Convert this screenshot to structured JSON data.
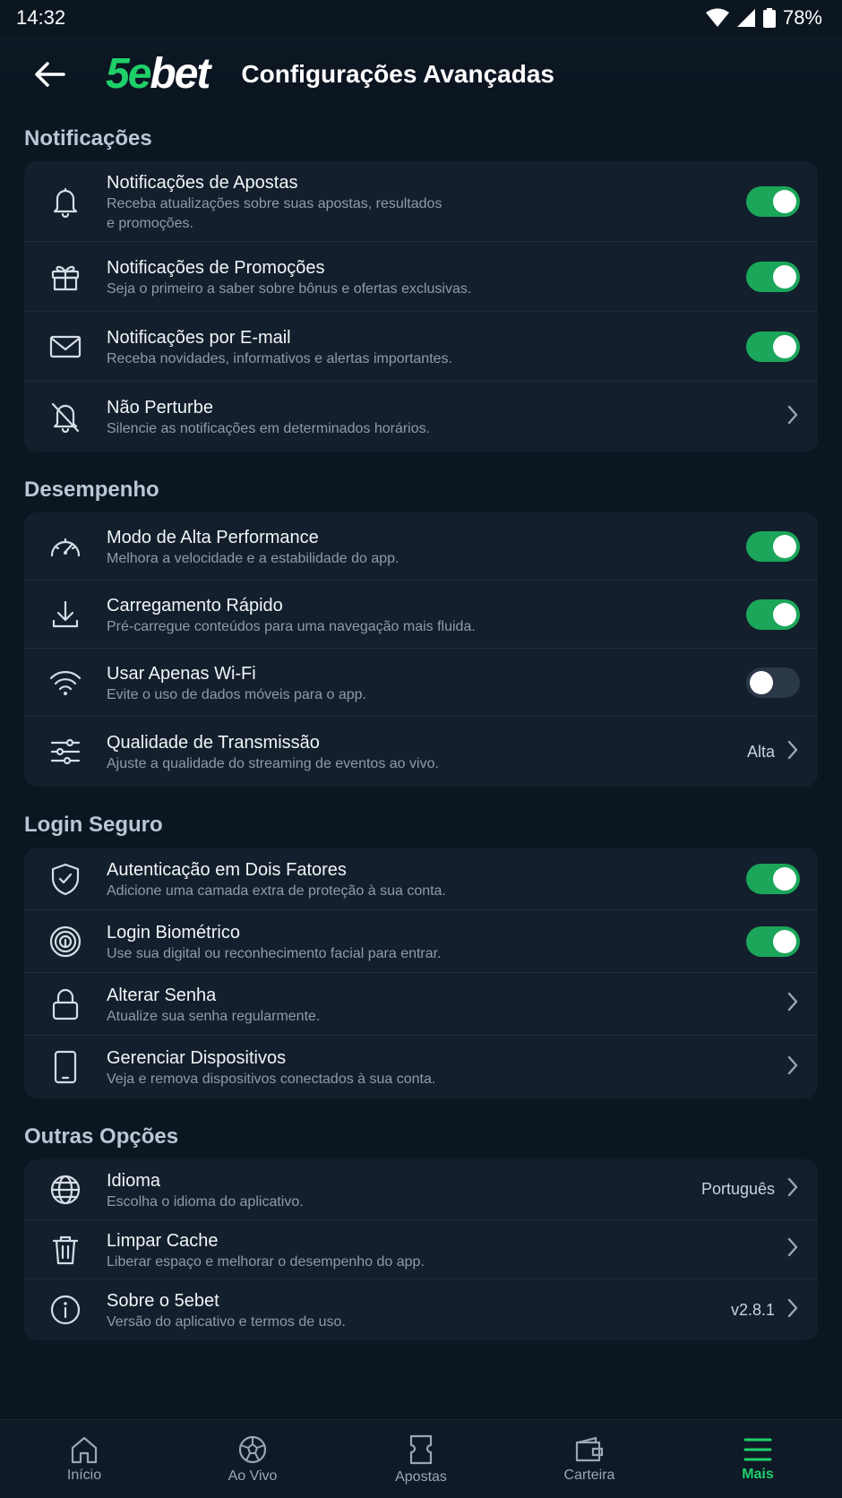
{
  "status": {
    "time": "14:32",
    "battery": "78%"
  },
  "header": {
    "logo_5": "5",
    "logo_e": "e",
    "logo_bet": "bet",
    "title": "Configurações Avançadas"
  },
  "sections": [
    {
      "title": "Notificações",
      "items": [
        {
          "icon": "bell-icon",
          "title": "Notificações de Apostas",
          "subtitle": "Receba atualizações sobre suas apostas, resultados\ne promoções.",
          "control": "toggle",
          "on": true
        },
        {
          "icon": "gift-icon",
          "title": "Notificações de Promoções",
          "subtitle": "Seja o primeiro a saber sobre bônus e ofertas exclusivas.",
          "control": "toggle",
          "on": true
        },
        {
          "icon": "mail-icon",
          "title": "Notificações por E-mail",
          "subtitle": "Receba novidades, informativos e alertas importantes.",
          "control": "toggle",
          "on": true
        },
        {
          "icon": "bell-off-icon",
          "title": "Não Perturbe",
          "subtitle": "Silencie as notificações em determinados horários.",
          "control": "chevron"
        }
      ]
    },
    {
      "title": "Desempenho",
      "items": [
        {
          "icon": "speedometer-icon",
          "title": "Modo de Alta Performance",
          "subtitle": "Melhora a velocidade e a estabilidade do app.",
          "control": "toggle",
          "on": true
        },
        {
          "icon": "download-icon",
          "title": "Carregamento Rápido",
          "subtitle": "Pré-carregue conteúdos para uma navegação mais fluida.",
          "control": "toggle",
          "on": true
        },
        {
          "icon": "wifi-icon",
          "title": "Usar Apenas Wi-Fi",
          "subtitle": "Evite o uso de dados móveis para o app.",
          "control": "toggle",
          "on": false
        },
        {
          "icon": "sliders-icon",
          "title": "Qualidade de Transmissão",
          "subtitle": "Ajuste a qualidade do streaming de eventos ao vivo.",
          "control": "chevron",
          "value": "Alta"
        }
      ]
    },
    {
      "title": "Login Seguro",
      "items": [
        {
          "icon": "shield-check-icon",
          "title": "Autenticação em Dois Fatores",
          "subtitle": "Adicione uma camada extra de proteção à sua conta.",
          "control": "toggle",
          "on": true
        },
        {
          "icon": "fingerprint-icon",
          "title": "Login Biométrico",
          "subtitle": "Use sua digital ou reconhecimento facial para entrar.",
          "control": "toggle",
          "on": true
        },
        {
          "icon": "lock-icon",
          "title": "Alterar Senha",
          "subtitle": "Atualize sua senha regularmente.",
          "control": "chevron"
        },
        {
          "icon": "phone-icon",
          "title": "Gerenciar Dispositivos",
          "subtitle": "Veja e remova dispositivos conectados à sua conta.",
          "control": "chevron"
        }
      ]
    },
    {
      "title": "Outras Opções",
      "items": [
        {
          "icon": "globe-icon",
          "title": "Idioma",
          "subtitle": "Escolha o idioma do aplicativo.",
          "control": "chevron",
          "value": "Português"
        },
        {
          "icon": "trash-icon",
          "title": "Limpar Cache",
          "subtitle": "Liberar espaço e melhorar o desempenho do app.",
          "control": "chevron"
        },
        {
          "icon": "info-icon",
          "title": "Sobre o 5ebet",
          "subtitle": "Versão do aplicativo e termos de uso.",
          "control": "chevron",
          "value": "v2.8.1"
        }
      ]
    }
  ],
  "bottom_nav": [
    {
      "icon": "home-icon",
      "label": "Início",
      "active": false
    },
    {
      "icon": "soccer-ball-icon",
      "label": "Ao Vivo",
      "active": false
    },
    {
      "icon": "ticket-icon",
      "label": "Apostas",
      "active": false
    },
    {
      "icon": "wallet-icon",
      "label": "Carteira",
      "active": false
    },
    {
      "icon": "menu-icon",
      "label": "Mais",
      "active": true
    }
  ],
  "colors": {
    "accent": "#1fd06a",
    "toggle_on": "#1ba65a",
    "background": "#0c1621",
    "card": "#131f2c"
  }
}
